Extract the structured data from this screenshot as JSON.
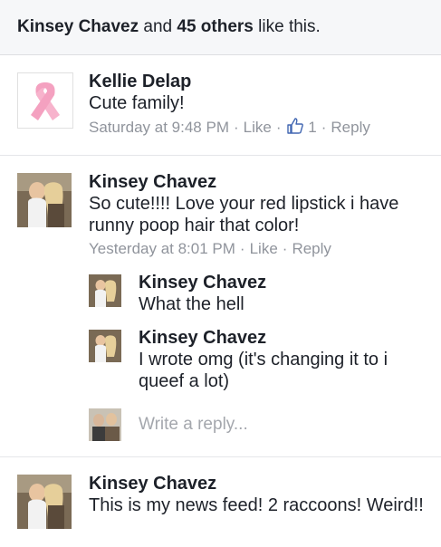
{
  "likes_summary": {
    "first_name": "Kinsey Chavez",
    "and_text": " and ",
    "others": "45 others",
    "suffix": " like this."
  },
  "comments": [
    {
      "author": "Kellie Delap",
      "text": "Cute family!",
      "time": "Saturday at 9:48 PM",
      "like_label": "Like",
      "reaction_count": "1",
      "reply_label": "Reply",
      "avatar_icon": "pink-ribbon-icon"
    },
    {
      "author": "Kinsey Chavez",
      "text": "So cute!!!! Love your red lipstick i have runny poop hair that color!",
      "time": "Yesterday at 8:01 PM",
      "like_label": "Like",
      "reply_label": "Reply",
      "replies": [
        {
          "author": "Kinsey Chavez",
          "text": "What the hell"
        },
        {
          "author": "Kinsey Chavez",
          "text": "I wrote omg (it's changing it to i queef a lot)"
        }
      ],
      "reply_placeholder": "Write a reply..."
    },
    {
      "author": "Kinsey Chavez",
      "text": "This is my news feed! 2 raccoons! Weird!!"
    }
  ],
  "meta_separator": "·",
  "colors": {
    "link_gray": "#90949c",
    "text": "#1d2129",
    "like_blue": "#4267b2",
    "ribbon_pink": "#f4a7c4"
  }
}
